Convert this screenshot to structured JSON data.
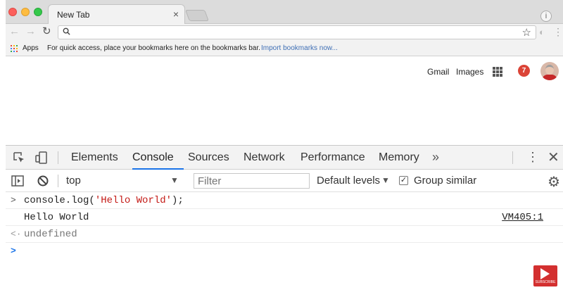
{
  "browser": {
    "tab_title": "New Tab",
    "tab_close": "×",
    "profile_glyph": "i",
    "nav": {
      "back": "←",
      "forward": "→",
      "reload": "↻"
    },
    "star": "☆",
    "ext": "◐",
    "menu": "⋮"
  },
  "bookmarks": {
    "apps_label": "Apps",
    "hint": "For quick access, place your bookmarks here on the bookmarks bar.",
    "import_link": "Import bookmarks now..."
  },
  "page": {
    "gmail": "Gmail",
    "images": "Images",
    "notifications": "7"
  },
  "devtools": {
    "tabs": [
      "Elements",
      "Console",
      "Sources",
      "Network",
      "Performance",
      "Memory"
    ],
    "active_tab": "Console",
    "more": "»",
    "kebab": "⋮",
    "close": "✕",
    "context": "top",
    "filter_placeholder": "Filter",
    "levels": "Default levels",
    "dropdown_arrow": "▼",
    "group_similar": "Group similar",
    "group_checked": "✓",
    "gear": "⚙",
    "accent": "#1a73e8"
  },
  "console": {
    "prompt_in": ">",
    "prompt_out": "<·",
    "input_prefix": "console.log(",
    "input_string": "'Hello World'",
    "input_suffix": ");",
    "output": "Hello World",
    "source": "VM405:1",
    "result": "undefined",
    "caret": ">"
  },
  "overlay": {
    "subscribe": "SUBSCRIBE"
  }
}
